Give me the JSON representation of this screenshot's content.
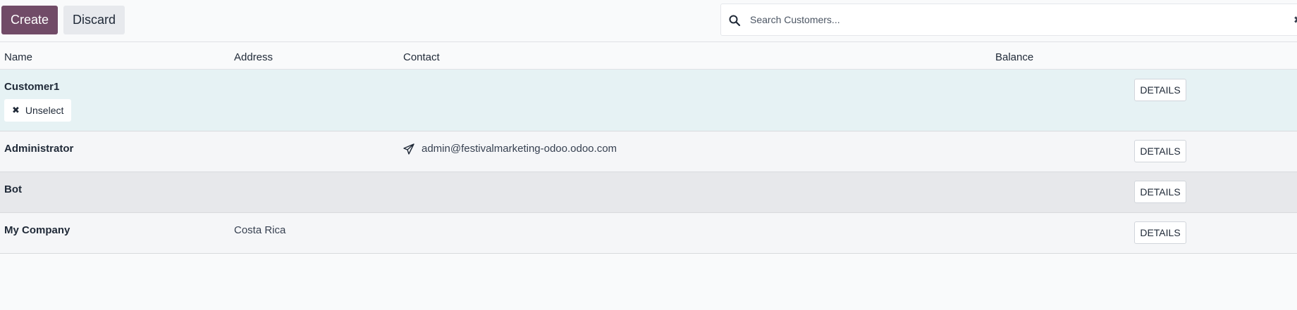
{
  "toolbar": {
    "create_label": "Create",
    "discard_label": "Discard"
  },
  "search": {
    "placeholder": "Search Customers...",
    "icon": "search-icon",
    "clear_icon": "close-icon"
  },
  "table": {
    "columns": [
      "Name",
      "Address",
      "Contact",
      "Balance"
    ],
    "rows": [
      {
        "name": "Customer1",
        "address": "",
        "contact": "",
        "balance": "",
        "details_label": "DETAILS",
        "selected": true,
        "unselect_label": "Unselect"
      },
      {
        "name": "Administrator",
        "address": "",
        "contact": "admin@festivalmarketing-odoo.odoo.com",
        "balance": "",
        "details_label": "DETAILS"
      },
      {
        "name": "Bot",
        "address": "",
        "contact": "",
        "balance": "",
        "details_label": "DETAILS"
      },
      {
        "name": "My Company",
        "address": "Costa Rica",
        "contact": "",
        "balance": "",
        "details_label": "DETAILS"
      }
    ]
  },
  "colors": {
    "primary": "#714b67",
    "selected_row": "#e6f2f4"
  }
}
